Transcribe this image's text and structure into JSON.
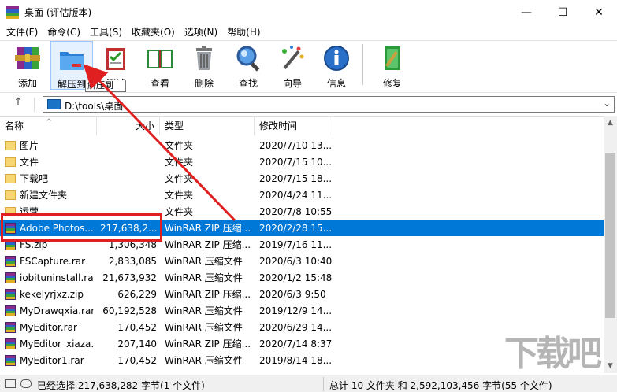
{
  "window": {
    "title": "桌面 (评估版本)",
    "minimize": "—",
    "maximize": "☐",
    "close": "✕"
  },
  "menu": [
    "文件(F)",
    "命令(C)",
    "工具(S)",
    "收藏夹(O)",
    "选项(N)",
    "帮助(H)"
  ],
  "toolbar": {
    "buttons": [
      {
        "label": "添加",
        "icon": "add-archive-icon"
      },
      {
        "label": "解压到",
        "icon": "extract-folder-icon"
      },
      {
        "label": "测试",
        "icon": "test-clipboard-icon"
      },
      {
        "label": "查看",
        "icon": "view-book-icon"
      },
      {
        "label": "删除",
        "icon": "trash-bin-icon"
      },
      {
        "label": "查找",
        "icon": "magnifier-icon"
      },
      {
        "label": "向导",
        "icon": "wizard-wand-icon"
      },
      {
        "label": "信息",
        "icon": "info-icon"
      },
      {
        "label": "修复",
        "icon": "repair-icon"
      }
    ],
    "tooltip": "解压到"
  },
  "address": {
    "up": "↑",
    "path": "D:\\tools\\桌面",
    "dropdown": "⌄"
  },
  "columns": {
    "name": "名称",
    "size": "大小",
    "type": "类型",
    "modified": "修改时间",
    "sort_arrow": "^"
  },
  "files": [
    {
      "name": "图片",
      "size": "",
      "type": "文件夹",
      "modified": "2020/7/10 13...",
      "kind": "folder"
    },
    {
      "name": "文件",
      "size": "",
      "type": "文件夹",
      "modified": "2020/7/15 10...",
      "kind": "folder"
    },
    {
      "name": "下载吧",
      "size": "",
      "type": "文件夹",
      "modified": "2020/7/15 18...",
      "kind": "folder"
    },
    {
      "name": "新建文件夹",
      "size": "",
      "type": "文件夹",
      "modified": "2020/4/24 11...",
      "kind": "folder"
    },
    {
      "name": "运营",
      "size": "",
      "type": "文件夹",
      "modified": "2020/7/8 10:55",
      "kind": "folder"
    },
    {
      "name": "Adobe Photos...",
      "size": "217,638,2...",
      "type": "WinRAR ZIP 压缩...",
      "modified": "2020/2/28 15...",
      "kind": "rar",
      "selected": true
    },
    {
      "name": "FS.zip",
      "size": "1,306,348",
      "type": "WinRAR ZIP 压缩...",
      "modified": "2019/7/16 11...",
      "kind": "rar"
    },
    {
      "name": "FSCapture.rar",
      "size": "2,833,085",
      "type": "WinRAR 压缩文件",
      "modified": "2020/6/3 10:40",
      "kind": "rar"
    },
    {
      "name": "iobituninstall.rar",
      "size": "21,673,932",
      "type": "WinRAR 压缩文件",
      "modified": "2020/1/2 15:48",
      "kind": "rar"
    },
    {
      "name": "kekelyrjxz.zip",
      "size": "626,229",
      "type": "WinRAR ZIP 压缩...",
      "modified": "2020/6/3 9:50",
      "kind": "rar"
    },
    {
      "name": "MyDrawqxia.rar",
      "size": "60,192,528",
      "type": "WinRAR 压缩文件",
      "modified": "2019/12/9 14...",
      "kind": "rar"
    },
    {
      "name": "MyEditor.rar",
      "size": "170,452",
      "type": "WinRAR 压缩文件",
      "modified": "2020/6/29 14...",
      "kind": "rar"
    },
    {
      "name": "MyEditor_xiaza...",
      "size": "207,140",
      "type": "WinRAR ZIP 压缩...",
      "modified": "2020/7/14 8:37",
      "kind": "rar"
    },
    {
      "name": "MyEditor1.rar",
      "size": "170,452",
      "type": "WinRAR 压缩文件",
      "modified": "2019/8/14 18...",
      "kind": "rar"
    }
  ],
  "status": {
    "left": "已经选择 217,638,282 字节(1 个文件)",
    "right": "总计 10 文件夹 和 2,592,103,456 字节(55 个文件)"
  },
  "scrollbar": {
    "up": "▲",
    "down": "▼"
  },
  "watermark": "下载吧",
  "colors": {
    "selection": "#0078d7",
    "annotation_red": "#e02020",
    "folder": "#f7d774"
  }
}
